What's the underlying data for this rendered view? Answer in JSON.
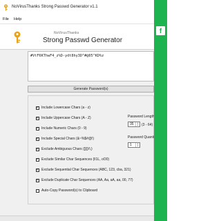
{
  "window": {
    "title": "NoVirusThanks Strong Passwd Generator v1.1"
  },
  "menu": {
    "items": [
      {
        "label": "File"
      },
      {
        "label": "Help"
      }
    ]
  },
  "header": {
    "brand": "NoVirusThanks",
    "title": "Strong Passwd Generator"
  },
  "password": {
    "value": "#VtF6KThwF4_z%D-ydt8hy3D^#@05^KD%z"
  },
  "generate_button": {
    "label": "Generate Password(s)"
  },
  "options": [
    {
      "label": "Include Lowercase Chars (a - z)",
      "checked": true
    },
    {
      "label": "Include Uppercase Chars (A - Z)",
      "checked": true
    },
    {
      "label": "Include Numeric Chars (0 - 9)",
      "checked": true
    },
    {
      "label": "Include Special Chars (&~%$#@!)",
      "checked": true
    },
    {
      "label": "Exclude Ambiguous Chars ([]{}/\\;)",
      "checked": true
    },
    {
      "label": "Exclude Similar Char Sequences (lI1L, oO0)",
      "checked": true
    },
    {
      "label": "Exclude Sequential Char Sequences (ABC, 123, cba, 321)",
      "checked": true
    },
    {
      "label": "Exclude Duplicate Char Sequences (AA, Aa, aA, aa, 00, 77)",
      "checked": true
    },
    {
      "label": "Auto-Copy Password(s) to Clipboard",
      "checked": false
    }
  ],
  "length": {
    "label": "Password Length",
    "value": "35",
    "range": "(3 - 64)"
  },
  "quantity": {
    "label": "Password Quantity",
    "value": "1"
  },
  "colors": {
    "side_accent": "#1db34f",
    "key_icon": "#e8a317"
  },
  "icons": {
    "app": "key-icon",
    "header": "key-icon",
    "side": "facebook-icon"
  }
}
